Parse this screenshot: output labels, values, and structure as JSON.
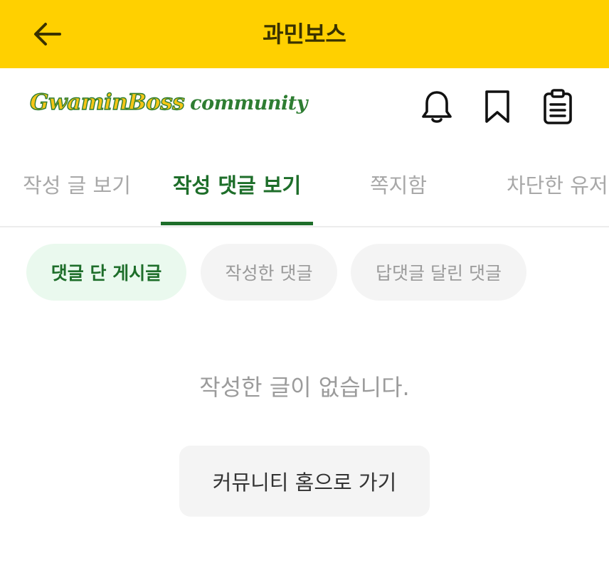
{
  "appbar": {
    "title": "과민보스",
    "back_icon": "arrow-left-icon",
    "background_color": "#FFD000"
  },
  "header": {
    "logo_main": "GwaminBoss",
    "logo_sub": "community",
    "icons": [
      "bell-icon",
      "bookmark-icon",
      "clipboard-icon"
    ]
  },
  "tabs": [
    {
      "label": "작성 글 보기",
      "active": false
    },
    {
      "label": "작성 댓글 보기",
      "active": true
    },
    {
      "label": "쪽지함",
      "active": false
    },
    {
      "label": "차단한 유저",
      "active": false
    }
  ],
  "chips": [
    {
      "label": "댓글 단 게시글",
      "active": true
    },
    {
      "label": "작성한 댓글",
      "active": false
    },
    {
      "label": "답댓글 달린 댓글",
      "active": false
    }
  ],
  "empty_state": {
    "message": "작성한 글이 없습니다.",
    "button_label": "커뮤니티 홈으로 가기"
  },
  "colors": {
    "accent": "#1e6e2a",
    "brand_yellow": "#FFD000"
  }
}
